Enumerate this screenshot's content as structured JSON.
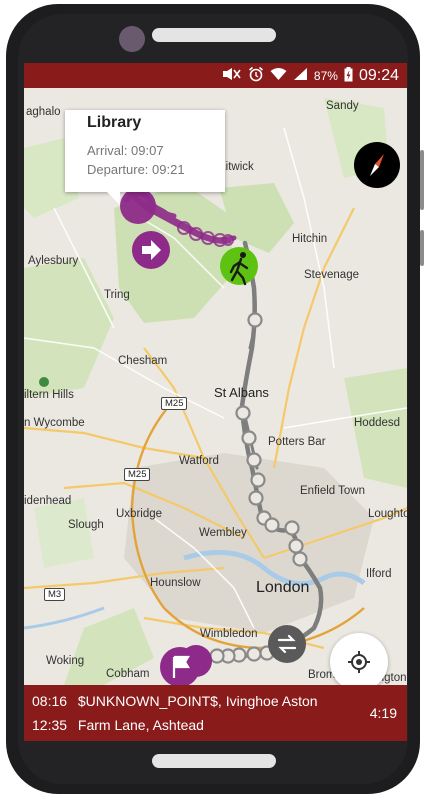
{
  "status_bar": {
    "battery_percent": "87%",
    "time": "09:24",
    "icons": [
      "mute-icon",
      "alarm-icon",
      "wifi-icon",
      "signal-icon",
      "battery-icon"
    ]
  },
  "popup": {
    "title": "Library",
    "arrival": "Arrival: 09:07",
    "departure": "Departure: 09:21"
  },
  "map_labels": {
    "aghalo": "aghalo",
    "sandy": "Sandy",
    "kitwick": "Kitwick",
    "hitchin": "Hitchin",
    "aylesbury": "Aylesbury",
    "stevenage": "Stevenage",
    "tring": "Tring",
    "chesham": "Chesham",
    "st_albans": "St Albans",
    "chiltern_hills": "iltern Hills",
    "wycombe": "n Wycombe",
    "hoddesd": "Hoddesd",
    "potters_bar": "Potters Bar",
    "watford": "Watford",
    "enfield_town": "Enfield Town",
    "denhead": "idenhead",
    "loughton": "Loughto",
    "slough": "Slough",
    "uxbridge": "Uxbridge",
    "wembley": "Wembley",
    "ilford": "Ilford",
    "hounslow": "Hounslow",
    "london": "London",
    "wimbledon": "Wimbledon",
    "woking": "Woking",
    "cobham": "Cobham",
    "bromley": "Brom",
    "orpington": "Orpington",
    "m25_a": "M25",
    "m25_b": "M25",
    "m3": "M3"
  },
  "trips": [
    {
      "time": "08:16",
      "place": "$UNKNOWN_POINT$, Ivinghoe Aston"
    },
    {
      "time": "12:35",
      "place": "Farm Lane, Ashtead"
    }
  ],
  "duration": "4:19",
  "colors": {
    "accent_red": "#8a1b1b",
    "track_purple": "#8e2a8a",
    "track_gray": "#808080",
    "walker_green": "#5ec212",
    "park_green": "#c8dcae"
  }
}
